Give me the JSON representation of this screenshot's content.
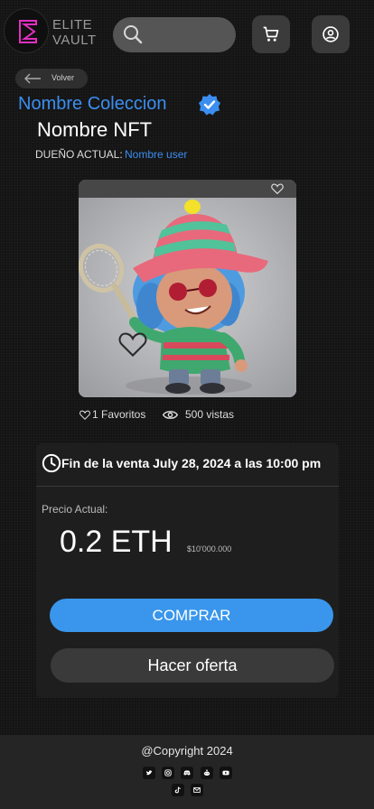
{
  "header": {
    "logo_text_line1": "ELITE",
    "logo_text_line2": "VAULT",
    "search_placeholder": "",
    "icons": [
      "search-icon",
      "cart-icon",
      "user-icon"
    ]
  },
  "back": {
    "label": "Volver"
  },
  "nft": {
    "collection": "Nombre Coleccion",
    "name": "Nombre NFT",
    "owner_label": "DUEÑO ACTUAL:",
    "owner_name": "Nombre user",
    "favorites": "1 Favoritos",
    "views": "500 vistas"
  },
  "sale": {
    "end_text": "Fin de  la venta July 28, 2024 a las 10:00 pm",
    "price_label": "Precio Actual:",
    "price": "0.2 ETH",
    "price_fiat": "$10'000.000",
    "buy_label": "COMPRAR",
    "offer_label": "Hacer oferta"
  },
  "footer": {
    "copyright": "@Copyright 2024",
    "social_icons": [
      "twitter-icon",
      "instagram-icon",
      "discord-icon",
      "reddit-icon",
      "youtube-icon",
      "tiktok-icon",
      "mail-icon"
    ]
  },
  "colors": {
    "accent": "#3b8ef0",
    "buy_button": "#3996ec",
    "panel": "#1e1e1e",
    "background": "#141414"
  }
}
